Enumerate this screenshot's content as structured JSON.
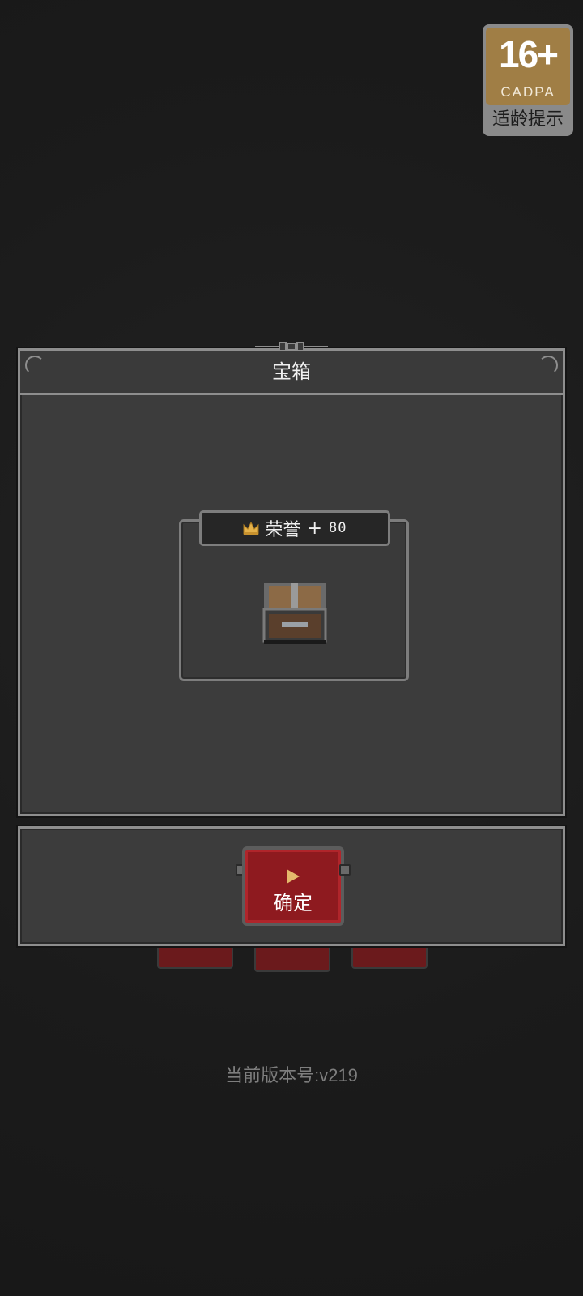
{
  "age_rating": {
    "age": "16+",
    "org": "CADPA",
    "tip": "适龄提示"
  },
  "dialog": {
    "title": "宝箱",
    "reward": {
      "icon": "crown-icon",
      "name": "荣誉",
      "plus": "+",
      "amount": "80",
      "item_icon": "treasure-chest-icon"
    },
    "confirm_label": "确定"
  },
  "version_text": "当前版本号:v219",
  "colors": {
    "background": "#1d1d1d",
    "panel": "#3c3c3c",
    "border": "#8e8e8e",
    "confirm_button": "#8e1a1f",
    "crown": "#e5b24a",
    "badge": "#a07e45"
  }
}
